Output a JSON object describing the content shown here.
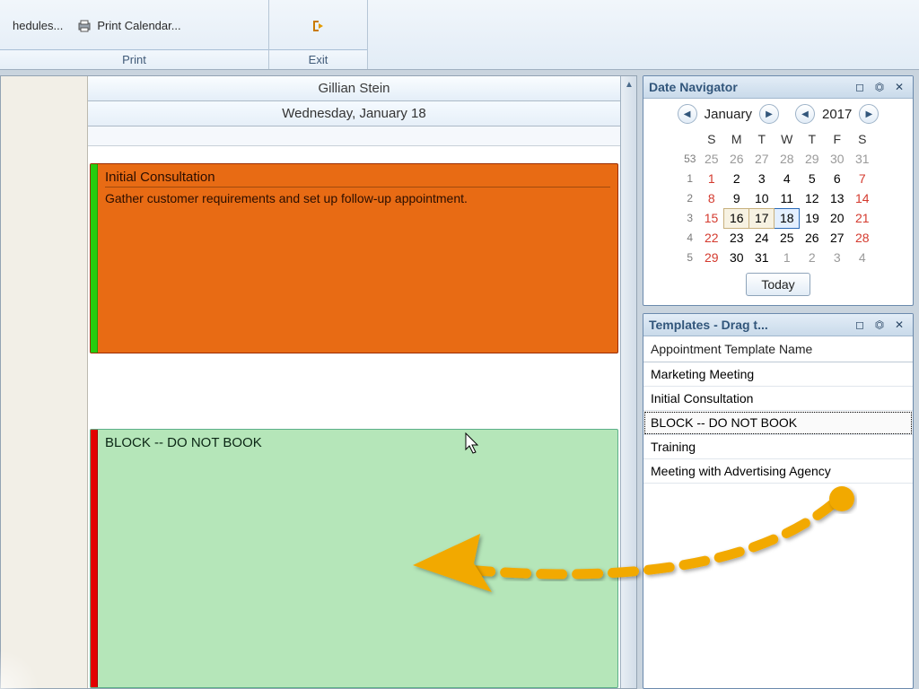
{
  "ribbon": {
    "print_schedules_label": "hedules...",
    "print_calendar_label": "Print Calendar...",
    "print_group": "Print",
    "exit_group": "Exit"
  },
  "calendar": {
    "person": "Gillian Stein",
    "date_label": "Wednesday, January 18",
    "event1_title": "Initial Consultation",
    "event1_desc": "Gather customer requirements and set up follow-up appointment.",
    "event2_title": "BLOCK -- DO NOT BOOK"
  },
  "date_nav": {
    "title": "Date Navigator",
    "month": "January",
    "year": "2017",
    "dow": [
      "S",
      "M",
      "T",
      "W",
      "T",
      "F",
      "S"
    ],
    "weeks": [
      {
        "wk": "53",
        "days": [
          "25",
          "26",
          "27",
          "28",
          "29",
          "30",
          "31"
        ],
        "dim": true
      },
      {
        "wk": "1",
        "days": [
          "1",
          "2",
          "3",
          "4",
          "5",
          "6",
          "7"
        ],
        "sun": [
          0,
          6
        ]
      },
      {
        "wk": "2",
        "days": [
          "8",
          "9",
          "10",
          "11",
          "12",
          "13",
          "14"
        ],
        "sun": [
          0,
          6
        ]
      },
      {
        "wk": "3",
        "days": [
          "15",
          "16",
          "17",
          "18",
          "19",
          "20",
          "21"
        ],
        "sun": [
          0,
          6
        ],
        "box": [
          1,
          2
        ],
        "sel": [
          3
        ]
      },
      {
        "wk": "4",
        "days": [
          "22",
          "23",
          "24",
          "25",
          "26",
          "27",
          "28"
        ],
        "sun": [
          0,
          6
        ]
      },
      {
        "wk": "5",
        "days": [
          "29",
          "30",
          "31",
          "1",
          "2",
          "3",
          "4"
        ],
        "sun": [
          0
        ],
        "dim_from": 3
      }
    ],
    "today": "Today"
  },
  "templates": {
    "title": "Templates - Drag t...",
    "column_header": "Appointment Template Name",
    "items": [
      "Marketing Meeting",
      "Initial Consultation",
      "BLOCK -- DO NOT BOOK",
      "Training",
      "Meeting with Advertising Agency"
    ],
    "selected_index": 2
  }
}
